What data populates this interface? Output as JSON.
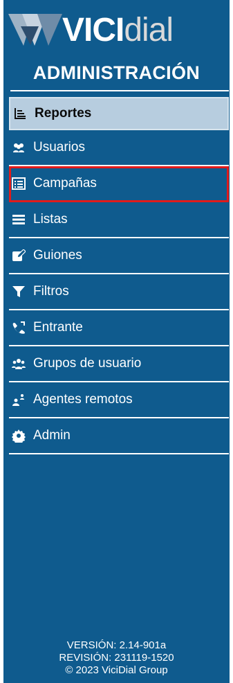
{
  "logo": {
    "brand_main": "VICI",
    "brand_tail": "dial"
  },
  "header": {
    "title": "ADMINISTRACIÓN"
  },
  "menu": {
    "items": [
      {
        "label": "Reportes",
        "icon": "bar-chart-icon",
        "state": "active"
      },
      {
        "label": "Usuarios",
        "icon": "users-icon",
        "state": "normal"
      },
      {
        "label": "Campañas",
        "icon": "list-box-icon",
        "state": "highlighted"
      },
      {
        "label": "Listas",
        "icon": "list-icon",
        "state": "normal"
      },
      {
        "label": "Guiones",
        "icon": "edit-icon",
        "state": "normal"
      },
      {
        "label": "Filtros",
        "icon": "filter-icon",
        "state": "normal"
      },
      {
        "label": "Entrante",
        "icon": "phone-inbound-icon",
        "state": "normal"
      },
      {
        "label": "Grupos de usuario",
        "icon": "user-group-icon",
        "state": "normal"
      },
      {
        "label": "Agentes remotos",
        "icon": "remote-agents-icon",
        "state": "normal"
      },
      {
        "label": "Admin",
        "icon": "gear-icon",
        "state": "normal"
      }
    ]
  },
  "footer": {
    "version": "VERSIÓN: 2.14-901a",
    "revision": "REVISIÓN: 231119-1520",
    "copyright": "© 2023 ViciDial Group"
  },
  "colors": {
    "panel": "#0f5b8e",
    "active_bg": "#b7cddf",
    "highlight_outline": "#e11b1b",
    "text": "#ffffff"
  }
}
